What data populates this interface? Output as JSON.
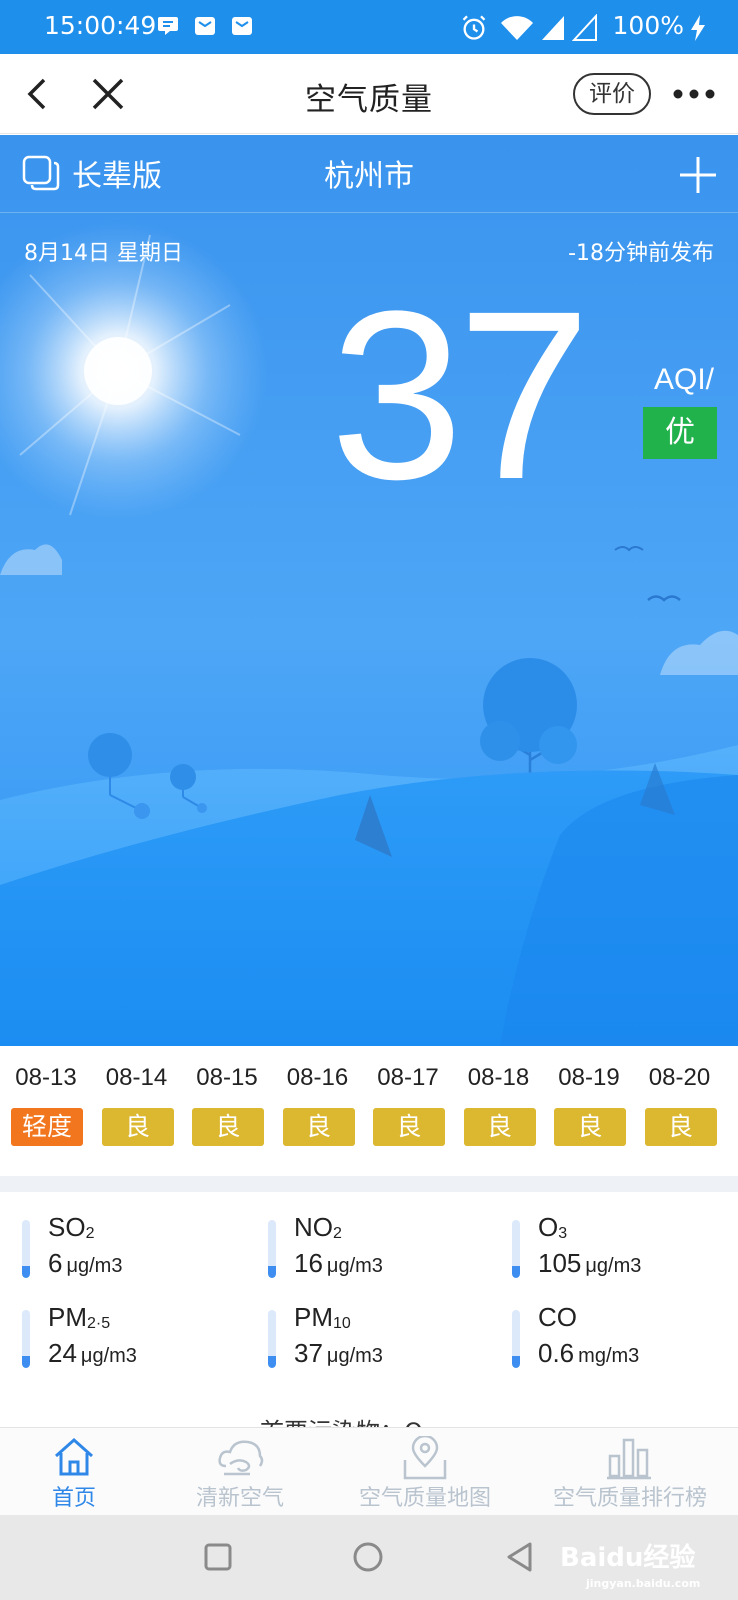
{
  "status_bar": {
    "time": "15:00:49",
    "battery": "100%"
  },
  "title_bar": {
    "title": "空气质量",
    "rate_label": "评价"
  },
  "hero": {
    "elder_mode_label": "长辈版",
    "city": "杭州市",
    "date": "8月14日 星期日",
    "publish_time": "-18分钟前发布",
    "aqi_value": "37",
    "aqi_label": "AQI/",
    "aqi_level": "优",
    "colors": {
      "sky_top": "#2f8fee",
      "sky_bottom": "#1a8cf2",
      "level_good": "#21b24c"
    }
  },
  "forecast": [
    {
      "date": "08-13",
      "level": "轻度",
      "color": "#f2761e"
    },
    {
      "date": "08-14",
      "level": "良",
      "color": "#dcb730"
    },
    {
      "date": "08-15",
      "level": "良",
      "color": "#dcb730"
    },
    {
      "date": "08-16",
      "level": "良",
      "color": "#dcb730"
    },
    {
      "date": "08-17",
      "level": "良",
      "color": "#dcb730"
    },
    {
      "date": "08-18",
      "level": "良",
      "color": "#dcb730"
    },
    {
      "date": "08-19",
      "level": "良",
      "color": "#dcb730"
    },
    {
      "date": "08-20",
      "level": "良",
      "color": "#dcb730"
    }
  ],
  "pollutants": [
    {
      "name": "SO",
      "sub": "2",
      "value": "6",
      "unit": "μg/m3"
    },
    {
      "name": "NO",
      "sub": "2",
      "value": "16",
      "unit": "μg/m3"
    },
    {
      "name": "O",
      "sub": "3",
      "value": "105",
      "unit": "μg/m3"
    },
    {
      "name": "PM",
      "sub": "2·5",
      "value": "24",
      "unit": "μg/m3"
    },
    {
      "name": "PM",
      "sub": "10",
      "value": "37",
      "unit": "μg/m3"
    },
    {
      "name": "CO",
      "sub": "",
      "value": "0.6",
      "unit": "mg/m3"
    }
  ],
  "peek_text": "首要污染物：O",
  "tabs": [
    {
      "label": "首页",
      "icon": "home-icon",
      "active": true
    },
    {
      "label": "清新空气",
      "icon": "cloud-wind-icon",
      "active": false
    },
    {
      "label": "空气质量地图",
      "icon": "map-pin-icon",
      "active": false
    },
    {
      "label": "空气质量排行榜",
      "icon": "bar-chart-icon",
      "active": false
    }
  ],
  "watermark": {
    "text": "Baidu经验",
    "sub": "jingyan.baidu.com"
  }
}
